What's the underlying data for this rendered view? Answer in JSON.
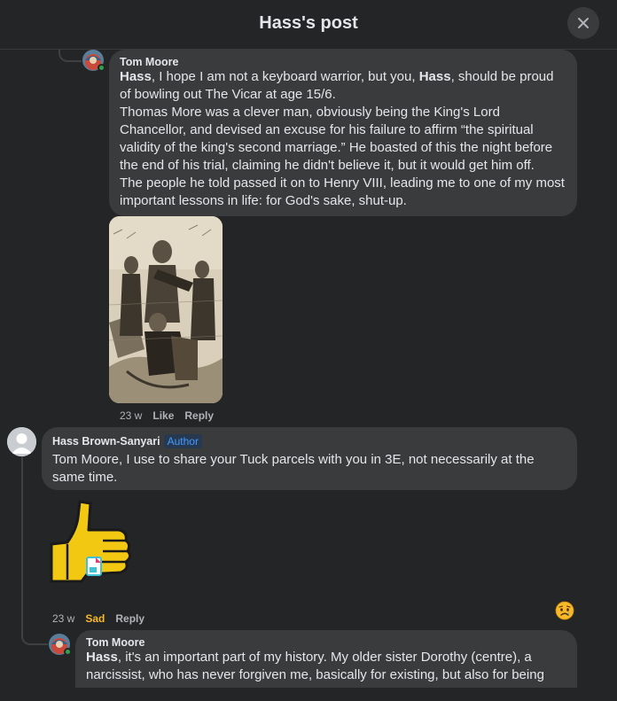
{
  "header": {
    "title": "Hass's post"
  },
  "comments": [
    {
      "author": "Tom Moore",
      "mention": "Hass",
      "line1_rest": ", I hope I am not a keyboard warrior, but you, ",
      "mention2": "Hass",
      "line1_end": ", should be proud of bowling out The Vicar at age 15/6.",
      "para2": "Thomas More was a clever man, obviously being the King's Lord Chancellor, and devised an excuse for his failure to affirm “the spiritual validity of the king's second marriage.” He boasted of this the night before the end of his trial, claiming he didn't believe it, but it would get him off.",
      "para3": "The people he told passed it on to Henry VIII, leading me to one of my most important lessons in life: for God's sake, shut-up.",
      "time": "23 w",
      "like": "Like",
      "reply": "Reply"
    },
    {
      "author": "Hass Brown-Sanyari",
      "badge": "Author",
      "text": "Tom Moore, I use to share your Tuck parcels with you in 3E, not necessarily at the same time.",
      "time": "23 w",
      "reaction_label": "Sad",
      "reply": "Reply",
      "reaction_icon": "sad-face-icon"
    },
    {
      "author": "Tom Moore",
      "mention": "Hass",
      "text": ", it's an important part of my history. My older sister Dorothy (centre), a narcissist, who has never forgiven me, basically for existing, but also for being"
    }
  ],
  "colors": {
    "background": "#242526",
    "bubble": "#3a3b3c",
    "sad": "#f7b928",
    "author_badge": "#4599ff",
    "online": "#31a24c"
  }
}
